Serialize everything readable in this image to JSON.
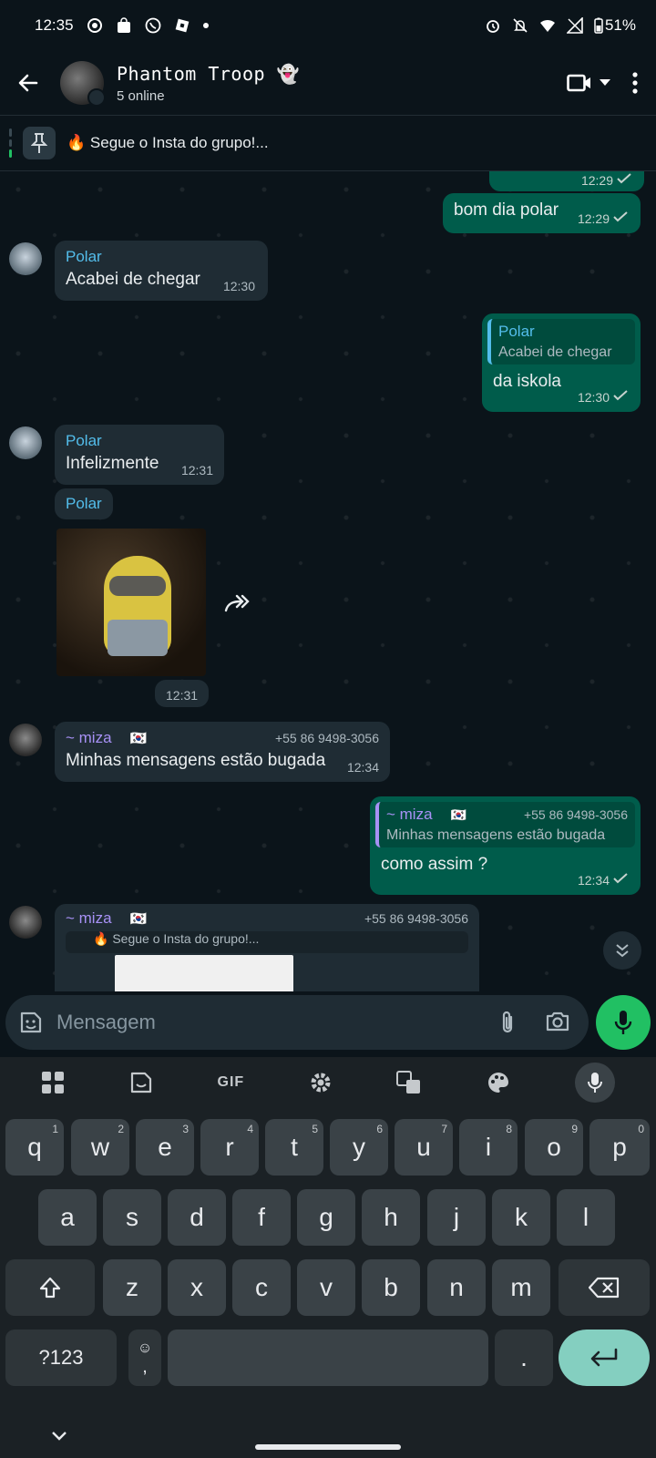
{
  "status_bar": {
    "time": "12:35",
    "battery": "51%"
  },
  "header": {
    "title": "Phantom Troop",
    "title_emoji": "👻",
    "subtitle": "5 online"
  },
  "pinned": {
    "emoji": "🔥",
    "text": "Segue o Insta do grupo!..."
  },
  "messages": {
    "m0": {
      "time": "12:29"
    },
    "m1": {
      "text": "bom dia polar",
      "time": "12:29"
    },
    "m2": {
      "sender": "Polar",
      "text": "Acabei de chegar",
      "time": "12:30"
    },
    "m3": {
      "quote_sender": "Polar",
      "quote_text": "Acabei de chegar",
      "text": "da iskola",
      "time": "12:30"
    },
    "m4": {
      "sender": "Polar",
      "text": "Infelizmente",
      "time": "12:31"
    },
    "m5": {
      "sender": "Polar",
      "time": "12:31"
    },
    "m6": {
      "sender": "~ miza",
      "flag": "🇰🇷",
      "phone": "+55 86 9498-3056",
      "text": "Minhas mensagens estão bugada",
      "time": "12:34"
    },
    "m7": {
      "quote_sender": "~ miza",
      "quote_flag": "🇰🇷",
      "quote_phone": "+55 86 9498-3056",
      "quote_text": "Minhas mensagens estão bugada",
      "text": "como assim ?",
      "time": "12:34"
    },
    "m8": {
      "sender": "~ miza",
      "flag": "🇰🇷",
      "phone": "+55 86 9498-3056",
      "quote_text": "🔥 Segue o Insta do grupo!..."
    }
  },
  "composer": {
    "placeholder": "Mensagem"
  },
  "keyboard": {
    "toolbar": {
      "gif": "GIF"
    },
    "row1": [
      "q",
      "w",
      "e",
      "r",
      "t",
      "y",
      "u",
      "i",
      "o",
      "p"
    ],
    "row1_hints": [
      "1",
      "2",
      "3",
      "4",
      "5",
      "6",
      "7",
      "8",
      "9",
      "0"
    ],
    "row2": [
      "a",
      "s",
      "d",
      "f",
      "g",
      "h",
      "j",
      "k",
      "l"
    ],
    "row3": [
      "z",
      "x",
      "c",
      "v",
      "b",
      "n",
      "m"
    ],
    "symbols": "?123",
    "emoji_key": "☺",
    "comma": ",",
    "period": "."
  },
  "colors": {
    "accent_green": "#21c063",
    "outgoing": "#005c4b",
    "incoming": "#1f2c34",
    "background": "#0b141a"
  }
}
